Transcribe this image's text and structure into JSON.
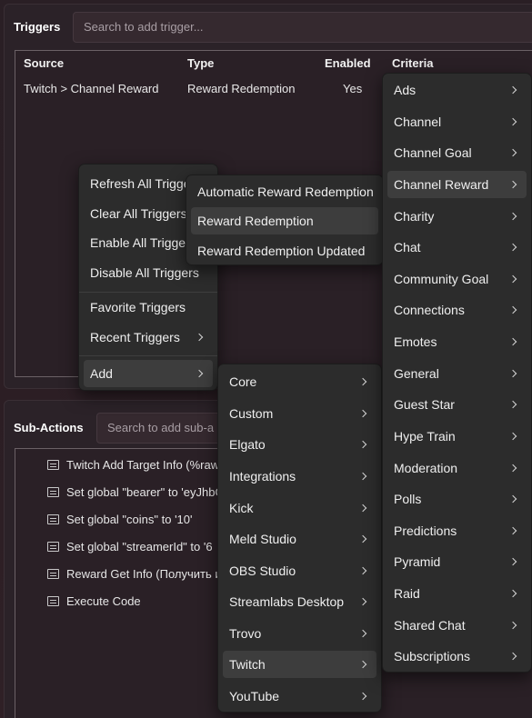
{
  "triggers": {
    "title": "Triggers",
    "search_placeholder": "Search to add trigger...",
    "columns": [
      "Source",
      "Type",
      "Enabled",
      "Criteria"
    ],
    "row": {
      "source": "Twitch > Channel Reward",
      "type": "Reward Redemption",
      "enabled": "Yes"
    }
  },
  "subactions": {
    "title": "Sub-Actions",
    "search_placeholder": "Search to add sub-a",
    "items": [
      "Twitch Add Target Info (%raw",
      "Set global \"bearer\" to 'eyJhbG",
      "Set global \"coins\" to '10'",
      "Set global \"streamerId\" to '6",
      "Reward Get Info (Получить и",
      "Execute Code"
    ]
  },
  "context_menu": {
    "items": [
      "Refresh All Triggers",
      "Clear All Triggers",
      "Enable All Triggers",
      "Disable All Triggers",
      "Favorite Triggers",
      "Recent Triggers",
      "Add"
    ]
  },
  "add_submenu": {
    "items": [
      "Core",
      "Custom",
      "Elgato",
      "Integrations",
      "Kick",
      "Meld Studio",
      "OBS Studio",
      "Streamlabs Desktop",
      "Trovo",
      "Twitch",
      "YouTube"
    ]
  },
  "twitch_submenu": {
    "items": [
      "Ads",
      "Channel",
      "Channel Goal",
      "Channel Reward",
      "Charity",
      "Chat",
      "Community Goal",
      "Connections",
      "Emotes",
      "General",
      "Guest Star",
      "Hype Train",
      "Moderation",
      "Polls",
      "Predictions",
      "Pyramid",
      "Raid",
      "Shared Chat",
      "Subscriptions"
    ]
  },
  "reward_submenu": {
    "items": [
      "Automatic Reward Redemption",
      "Reward Redemption",
      "Reward Redemption Updated"
    ]
  }
}
